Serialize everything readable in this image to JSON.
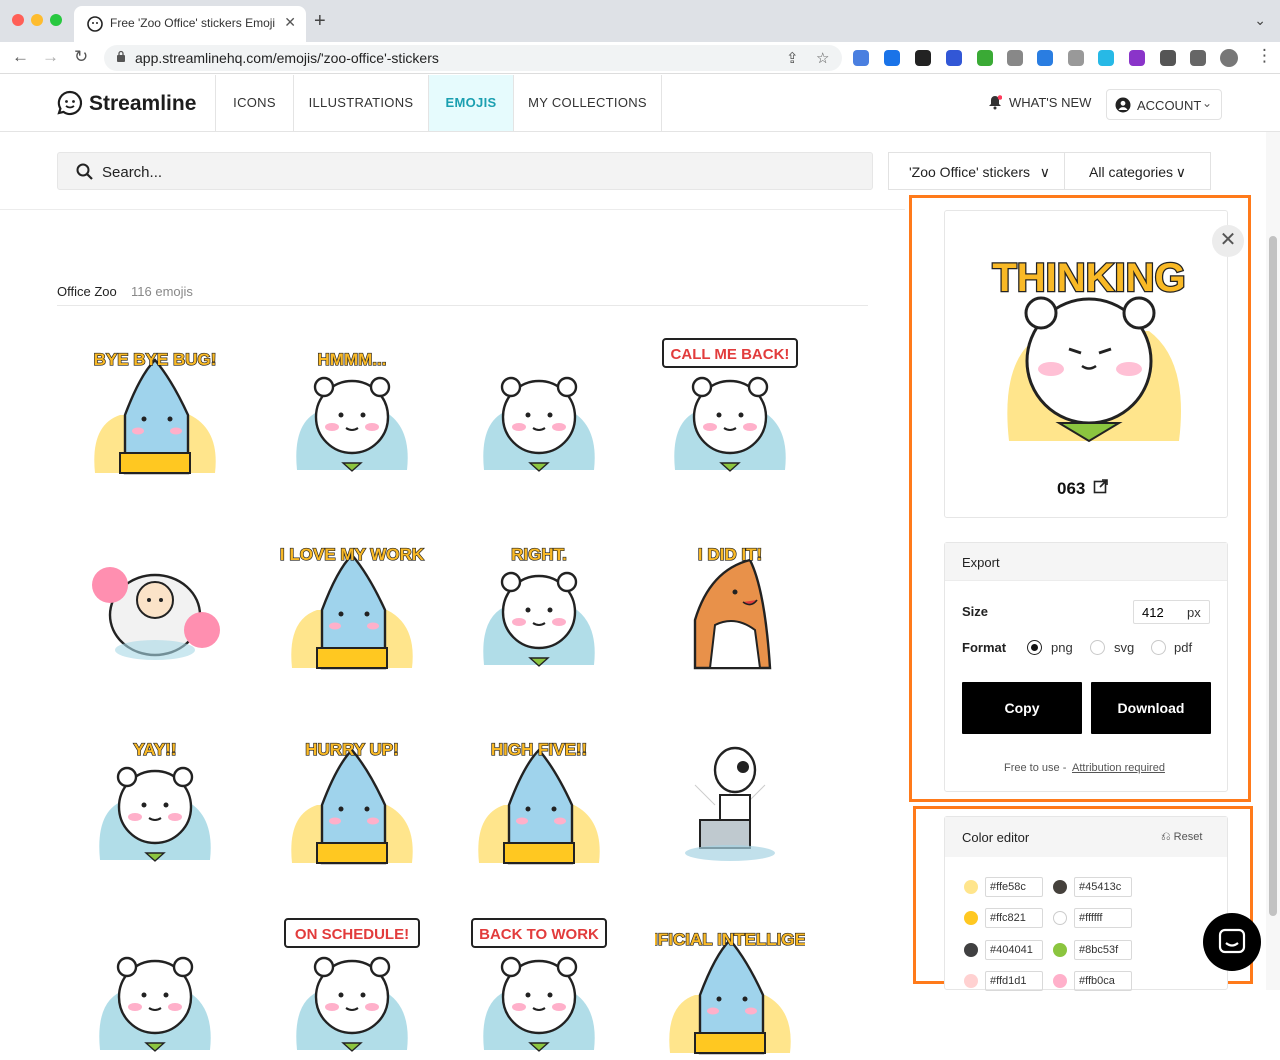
{
  "browser": {
    "tab_title": "Free 'Zoo Office' stickers Emoji",
    "url": "app.streamlinehq.com/emojis/'zoo-office'-stickers"
  },
  "header": {
    "logo_text": "Streamline",
    "nav": [
      "ICONS",
      "ILLUSTRATIONS",
      "EMOJIS",
      "MY COLLECTIONS"
    ],
    "whats_new": "WHAT'S NEW",
    "account": "ACCOUNT"
  },
  "search": {
    "placeholder": "Search...",
    "pack_filter": "'Zoo Office' stickers",
    "category_filter": "All categories"
  },
  "gallery": {
    "section_title": "Office Zoo",
    "section_count": "116 emojis",
    "stickers": [
      {
        "caption": "BYE BYE BUG!",
        "char": "shark"
      },
      {
        "caption": "HMMM...",
        "char": "bear"
      },
      {
        "caption": "",
        "char": "bear"
      },
      {
        "caption": "CALL ME BACK!",
        "char": "bear"
      },
      {
        "caption": "",
        "char": "sheep"
      },
      {
        "caption": "I LOVE MY WORK",
        "char": "shark"
      },
      {
        "caption": "RIGHT.",
        "char": "bear"
      },
      {
        "caption": "I DID IT!",
        "char": "fox"
      },
      {
        "caption": "YAY!!",
        "char": "bear"
      },
      {
        "caption": "HURRY UP!",
        "char": "shark"
      },
      {
        "caption": "HIGH FIVE!!",
        "char": "shark"
      },
      {
        "caption": "",
        "char": "skeleton"
      },
      {
        "caption": "",
        "char": "bear"
      },
      {
        "caption": "ON SCHEDULE!",
        "char": "bear"
      },
      {
        "caption": "BACK TO WORK",
        "char": "bear"
      },
      {
        "caption": "ARTIFICIAL INTELLIGENCE",
        "char": "shark"
      }
    ]
  },
  "preview": {
    "caption": "THINKING",
    "id": "063"
  },
  "export": {
    "title": "Export",
    "size_label": "Size",
    "size_value": "412",
    "size_unit": "px",
    "format_label": "Format",
    "formats": [
      "png",
      "svg",
      "pdf"
    ],
    "selected_format": "png",
    "copy": "Copy",
    "download": "Download",
    "free_text": "Free to use -",
    "attribution": "Attribution required"
  },
  "color_editor": {
    "title": "Color editor",
    "reset": "Reset",
    "colors": [
      [
        "#ffe58c",
        "#45413c"
      ],
      [
        "#ffc821",
        "#ffffff"
      ],
      [
        "#404041",
        "#8bc53f"
      ],
      [
        "#ffd1d1",
        "#ffb0ca"
      ]
    ]
  },
  "colors": {
    "accent": "#1a9fb0",
    "highlight": "#ff7a1a",
    "sticker_yellow": "#f9b926",
    "sticker_blue": "#a9d9e6"
  }
}
